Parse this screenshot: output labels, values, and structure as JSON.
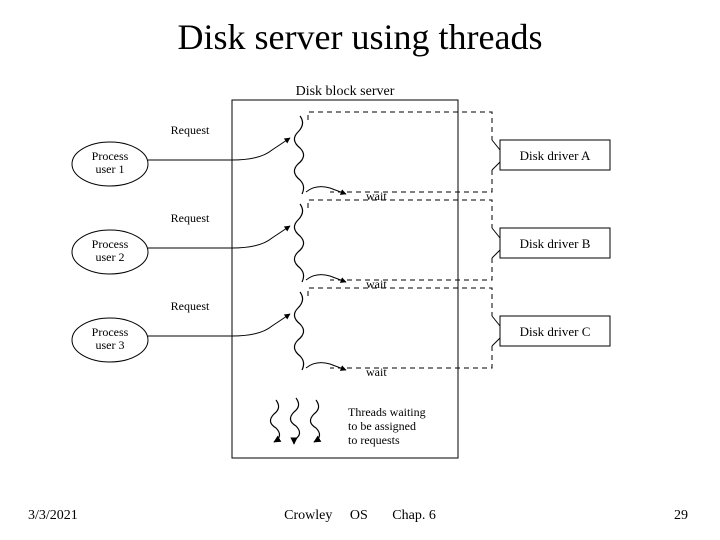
{
  "title": "Disk server using threads",
  "diagram": {
    "server_title": "Disk block server",
    "users": [
      {
        "label": "Process\nuser 1",
        "request": "Request",
        "wait": "wait"
      },
      {
        "label": "Process\nuser 2",
        "request": "Request",
        "wait": "wait"
      },
      {
        "label": "Process\nuser 3",
        "request": "Request",
        "wait": "wait"
      }
    ],
    "drivers": [
      {
        "label": "Disk driver A"
      },
      {
        "label": "Disk driver B"
      },
      {
        "label": "Disk driver C"
      }
    ],
    "pool_label": "Threads waiting\nto be assigned\nto requests"
  },
  "footer": {
    "date": "3/3/2021",
    "author": "Crowley",
    "course": "OS",
    "chapter": "Chap. 6",
    "page": "29"
  }
}
